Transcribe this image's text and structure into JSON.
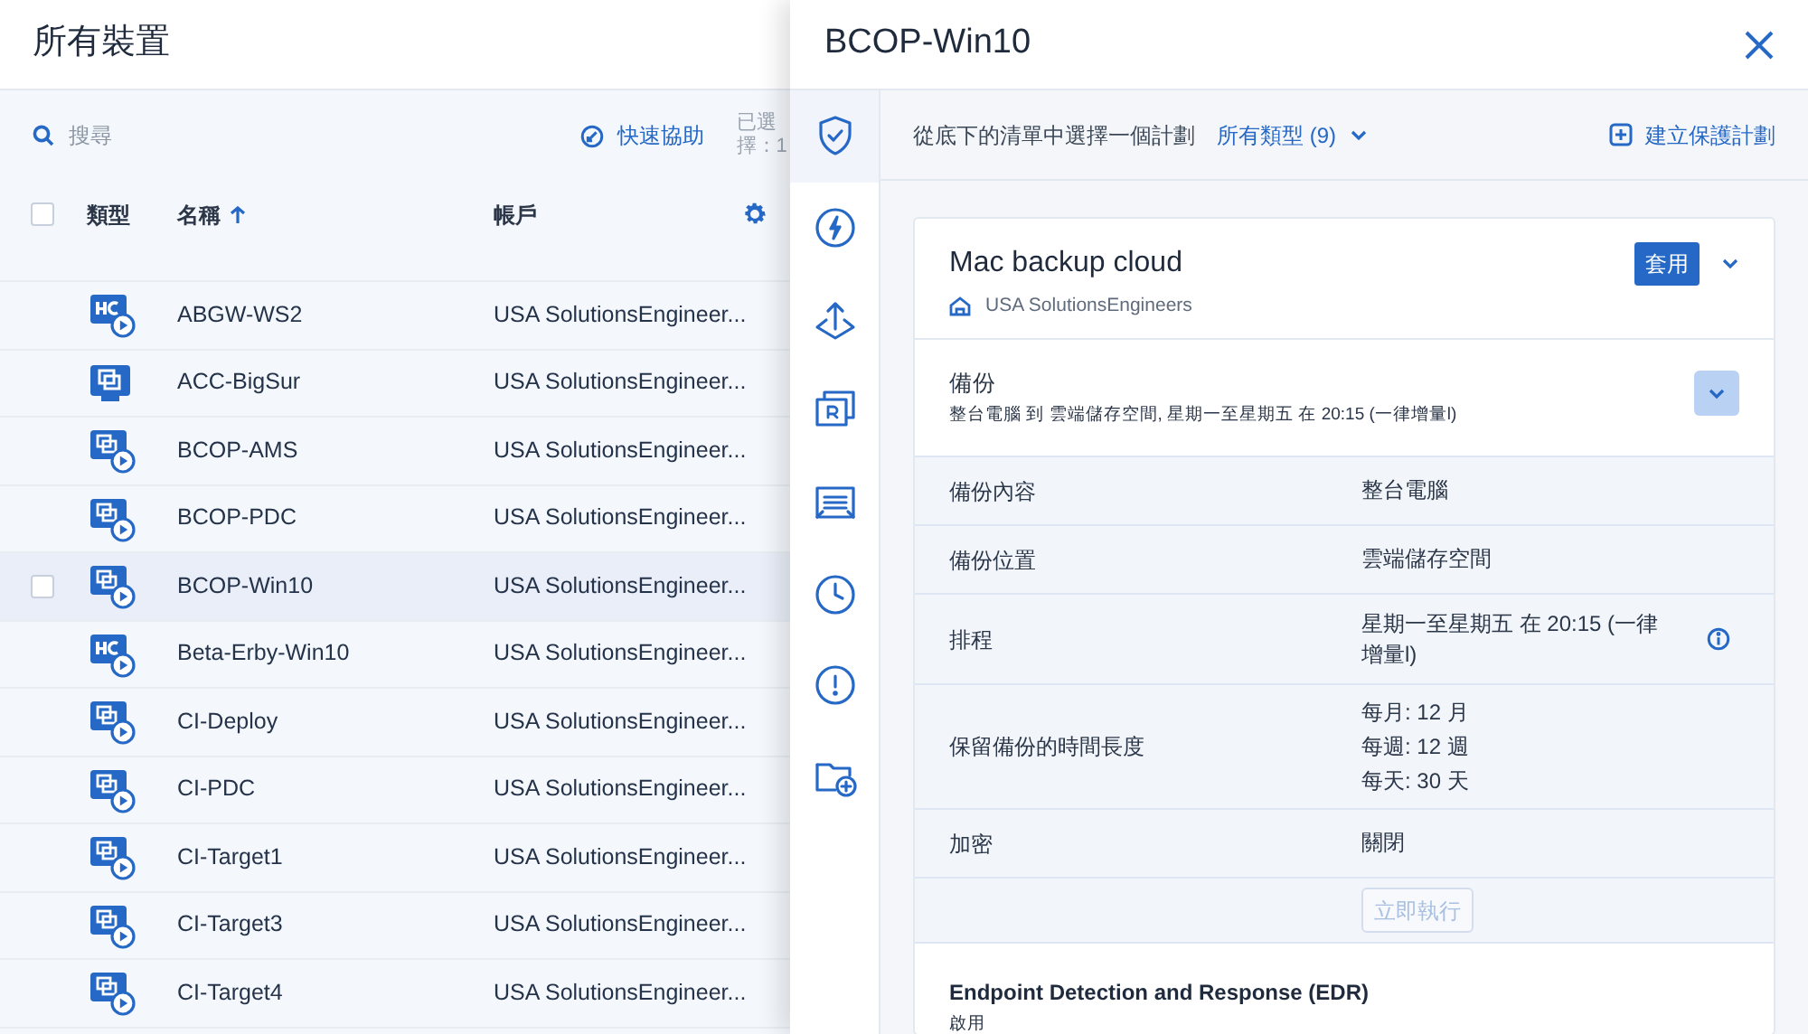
{
  "page": {
    "title": "所有裝置"
  },
  "toolbar": {
    "search_placeholder": "搜尋",
    "quick_assist": "快速協助",
    "selection": "已選擇：1"
  },
  "table": {
    "select_all": {
      "checked": false
    },
    "columns": [
      {
        "label": "類型"
      },
      {
        "label": "名稱",
        "sorted_ascending": true
      },
      {
        "label": "帳戶"
      }
    ],
    "rows": [
      {
        "kind": "hyperv",
        "name": "ABGW-WS2",
        "account": "USA SolutionsEngineer...",
        "selected": false
      },
      {
        "kind": "mac",
        "name": "ACC-BigSur",
        "account": "USA SolutionsEngineer...",
        "selected": false
      },
      {
        "kind": "vm",
        "name": "BCOP-AMS",
        "account": "USA SolutionsEngineer...",
        "selected": false
      },
      {
        "kind": "vm",
        "name": "BCOP-PDC",
        "account": "USA SolutionsEngineer...",
        "selected": false
      },
      {
        "kind": "vm",
        "name": "BCOP-Win10",
        "account": "USA SolutionsEngineer...",
        "selected": true
      },
      {
        "kind": "hyperv",
        "name": "Beta-Erby-Win10",
        "account": "USA SolutionsEngineer...",
        "selected": false
      },
      {
        "kind": "vm",
        "name": "CI-Deploy",
        "account": "USA SolutionsEngineer...",
        "selected": false
      },
      {
        "kind": "vm",
        "name": "CI-PDC",
        "account": "USA SolutionsEngineer...",
        "selected": false
      },
      {
        "kind": "vm",
        "name": "CI-Target1",
        "account": "USA SolutionsEngineer...",
        "selected": false
      },
      {
        "kind": "vm",
        "name": "CI-Target3",
        "account": "USA SolutionsEngineer...",
        "selected": false
      },
      {
        "kind": "vm",
        "name": "CI-Target4",
        "account": "USA SolutionsEngineer...",
        "selected": false
      }
    ]
  },
  "drawer": {
    "title": "BCOP-Win10",
    "rail": [
      {
        "kind": "shield",
        "selected": true
      },
      {
        "kind": "bolt",
        "selected": false
      },
      {
        "kind": "upload",
        "selected": false
      },
      {
        "kind": "recovery",
        "selected": false
      },
      {
        "kind": "document",
        "selected": false
      },
      {
        "kind": "clock",
        "selected": false
      },
      {
        "kind": "alert",
        "selected": false
      },
      {
        "kind": "folder",
        "selected": false
      }
    ],
    "plan_bar": {
      "prompt": "從底下的清單中選擇一個計劃",
      "filter": "所有類型 (9)",
      "create": "建立保護計劃"
    },
    "plan": {
      "name": "Mac backup cloud",
      "owner": "USA SolutionsEngineers",
      "apply": "套用",
      "sections": [
        {
          "title": "備份",
          "summary": "整台電腦 到 雲端儲存空間, 星期一至星期五 在 20:15 (一律增量l)",
          "expanded": true,
          "details": [
            {
              "label": "備份內容",
              "values": [
                "整台電腦"
              ],
              "info": false
            },
            {
              "label": "備份位置",
              "values": [
                "雲端儲存空間"
              ],
              "info": false
            },
            {
              "label": "排程",
              "values": [
                "星期一至星期五 在 20:15 (一律增量l)"
              ],
              "info": true
            },
            {
              "label": "保留備份的時間長度",
              "values": [
                "每月: 12 月",
                "每週: 12 週",
                "每天: 30 天"
              ],
              "info": false
            },
            {
              "label": "加密",
              "values": [
                "關閉"
              ],
              "info": false
            }
          ],
          "run": {
            "label": "立即執行",
            "disabled": true
          }
        },
        {
          "title": "Endpoint Detection and Response (EDR)",
          "summary": "啟用"
        }
      ]
    }
  }
}
